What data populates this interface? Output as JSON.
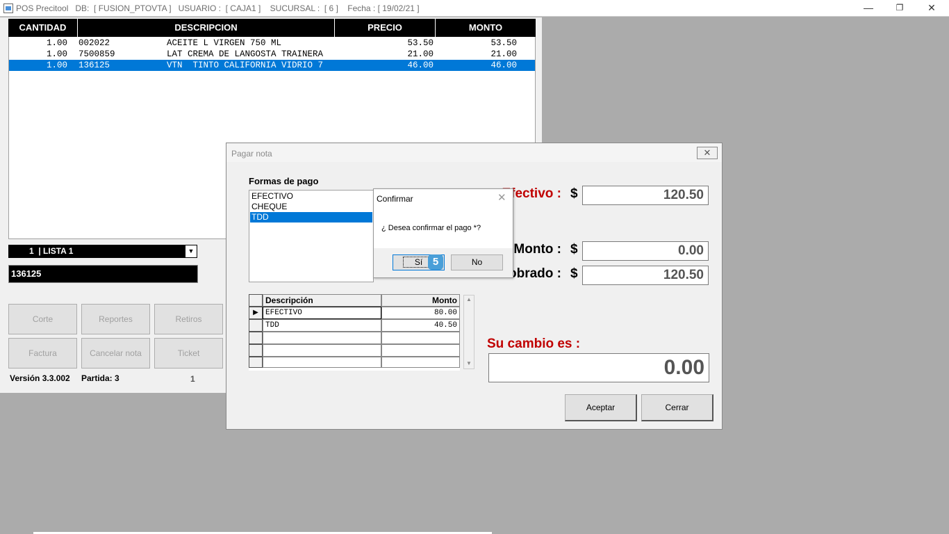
{
  "titlebar": {
    "text": "POS Precitool   DB:  [ FUSION_PTOVTA ]   USUARIO :  [ CAJA1 ]    SUCURSAL :  [ 6 ]    Fecha : [ 19/02/21 ]",
    "minimize": "—",
    "restore": "❐",
    "close": "✕"
  },
  "grid": {
    "headers": [
      "CANTIDAD",
      "DESCRIPCION",
      "PRECIO",
      "MONTO"
    ],
    "rows": [
      {
        "cantidad": "1.00",
        "codigo": "002022",
        "descripcion": "ACEITE L VIRGEN 750 ML",
        "precio": "53.50",
        "monto": "53.50"
      },
      {
        "cantidad": "1.00",
        "codigo": "7500859",
        "descripcion": "LAT CREMA DE LANGOSTA TRAINERA",
        "precio": "21.00",
        "monto": "21.00"
      },
      {
        "cantidad": "1.00",
        "codigo": "136125",
        "descripcion": "VTN  TINTO CALIFORNIA VIDRIO 7",
        "precio": "46.00",
        "monto": "46.00"
      }
    ]
  },
  "lista": {
    "value": "1  | LISTA 1",
    "arrow": "▼"
  },
  "code_input": {
    "value": "136125"
  },
  "buttons": {
    "corte": "Corte",
    "reportes": "Reportes",
    "retiros": "Retiros",
    "factura": "Factura",
    "cancelar_nota": "Cancelar nota",
    "ticket": "Ticket"
  },
  "status": {
    "version": "Versión 3.3.002",
    "partida": "Partida: 3",
    "count": "1"
  },
  "pagar": {
    "title": "Pagar nota",
    "close": "✕",
    "formas_label": "Formas de pago",
    "formas": [
      "EFECTIVO",
      "CHEQUE",
      "TDD"
    ],
    "grid_headers": [
      "Descripción",
      "Monto"
    ],
    "grid_rows": [
      {
        "desc": "EFECTIVO",
        "monto": "80.00"
      },
      {
        "desc": "TDD",
        "monto": "40.50"
      }
    ],
    "row_indicator": "▶",
    "scroll_up": "▲",
    "scroll_down": "▼",
    "efectivo_label": "Efectivo :",
    "efectivo_value": "120.50",
    "monto_label": "Monto :",
    "monto_value": "0.00",
    "cobrado_label": "Cobrado :",
    "cobrado_value": "120.50",
    "dollar": "$",
    "cambio_label": "Su cambio es :",
    "cambio_value": "0.00",
    "aceptar": "Aceptar",
    "cerrar": "Cerrar"
  },
  "confirm": {
    "title": "Confirmar",
    "close": "✕",
    "message": "¿ Desea confirmar el pago *?",
    "si": "Sí",
    "no": "No",
    "badge": "5"
  }
}
